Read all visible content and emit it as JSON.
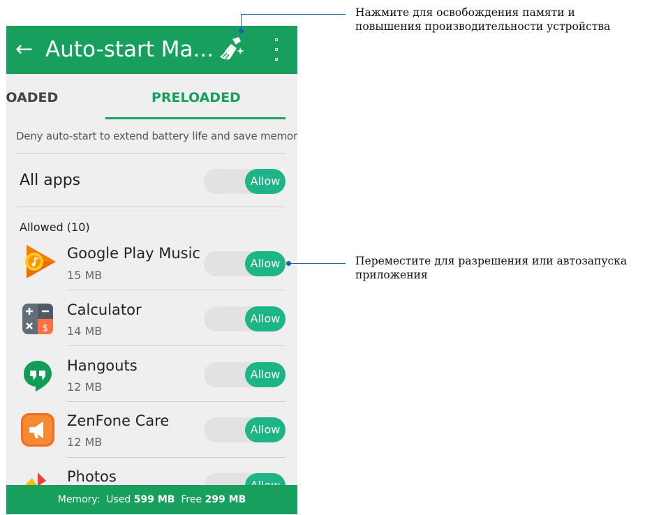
{
  "appbar": {
    "back_icon": "arrow-left",
    "title": "Auto-start Ma...",
    "clean_icon": "broom",
    "more_icon": "more-vertical"
  },
  "tabs": [
    {
      "label": "DOWNLOADED",
      "visible_label": "LOADED",
      "selected": false
    },
    {
      "label": "PRELOADED",
      "selected": true
    }
  ],
  "hint": "Deny auto-start to extend battery life and save memory.",
  "all_apps": {
    "label": "All apps",
    "toggle": "Allow"
  },
  "allowed_header": "Allowed (10)",
  "apps": [
    {
      "name": "Google Play Music",
      "size": "15 MB",
      "toggle": "Allow",
      "icon": "play-music"
    },
    {
      "name": "Calculator",
      "size": "14 MB",
      "toggle": "Allow",
      "icon": "calculator"
    },
    {
      "name": "Hangouts",
      "size": "12 MB",
      "toggle": "Allow",
      "icon": "hangouts"
    },
    {
      "name": "ZenFone Care",
      "size": "12 MB",
      "toggle": "Allow",
      "icon": "zenfone-care"
    },
    {
      "name": "Photos",
      "size": "",
      "toggle": "Allow",
      "icon": "photos"
    }
  ],
  "footer": {
    "prefix": "Memory:",
    "used_label": "Used",
    "used_value": "599 MB",
    "free_label": "Free",
    "free_value": "299 MB"
  },
  "callouts": [
    {
      "text_line1": "Нажмите для освобождения памяти и",
      "text_line2": "повышения производительности устройства"
    },
    {
      "text_line1": "Переместите для разрешения или автозапуска",
      "text_line2": "приложения"
    }
  ],
  "colors": {
    "brand": "#17a05d",
    "toggle_on": "#1db486",
    "callout": "#1f5fa8"
  }
}
